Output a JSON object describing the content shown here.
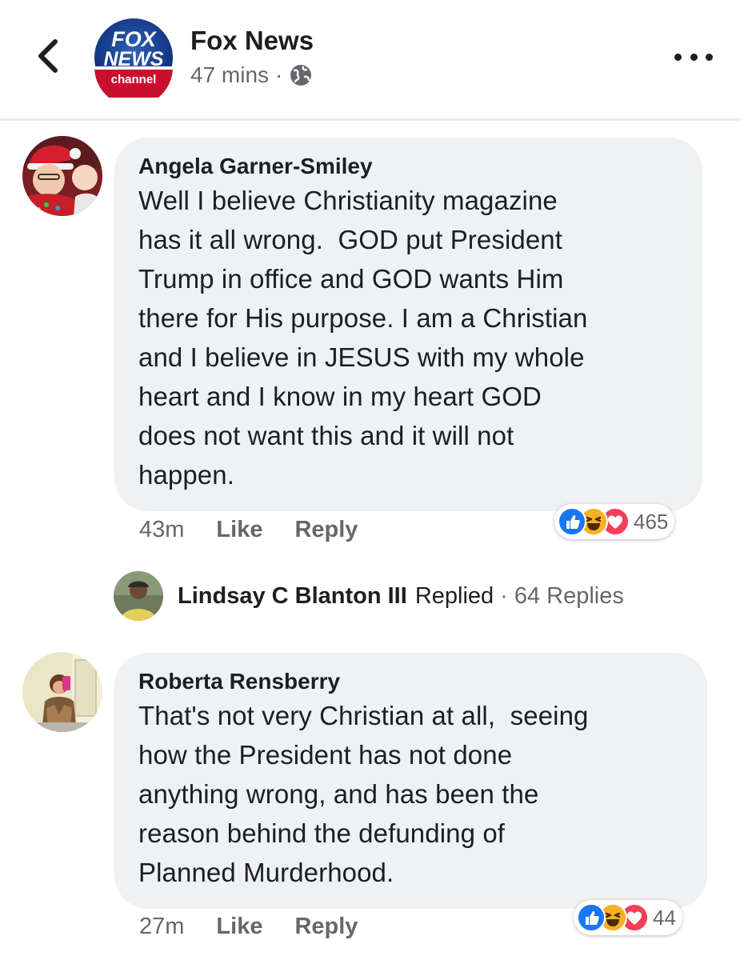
{
  "header": {
    "back_icon": "chevron-left-icon",
    "page_name": "Fox News",
    "logo_line1": "FOX",
    "logo_line2": "NEWS",
    "logo_line3": "channel",
    "time": "47 mins",
    "separator": "·",
    "privacy_icon": "globe-icon",
    "more_icon": "more-horizontal-icon"
  },
  "comments": [
    {
      "author": "Angela Garner-Smiley",
      "text": "Well I believe Christianity magazine\nhas it all wrong.  GOD put President\nTrump in office and GOD wants Him\nthere for His purpose. I am a Christian\nand I believe in JESUS with my whole\nheart and I know in my heart GOD\ndoes not want this and it will not\nhappen.",
      "time": "43m",
      "like_label": "Like",
      "reply_label": "Reply",
      "reaction_icons": [
        "like-icon",
        "haha-icon",
        "love-icon"
      ],
      "reaction_count": "465"
    },
    {
      "author": "Roberta Rensberry",
      "text": "That's not very Christian at all,  seeing\nhow the President has not done\nanything wrong, and has been the\nreason behind the defunding of\nPlanned Murderhood.",
      "time": "27m",
      "like_label": "Like",
      "reply_label": "Reply",
      "reaction_icons": [
        "like-icon",
        "haha-icon",
        "love-icon"
      ],
      "reaction_count": "44"
    }
  ],
  "replies": {
    "name": "Lindsay C Blanton III",
    "verb": "Replied",
    "separator": "·",
    "count": "64 Replies"
  },
  "colors": {
    "bubble": "#f0f1f3",
    "secondary_text": "#65676b",
    "like_blue": "#1877f2",
    "love_red": "#f33e58",
    "haha_yellow": "#f7b125"
  }
}
